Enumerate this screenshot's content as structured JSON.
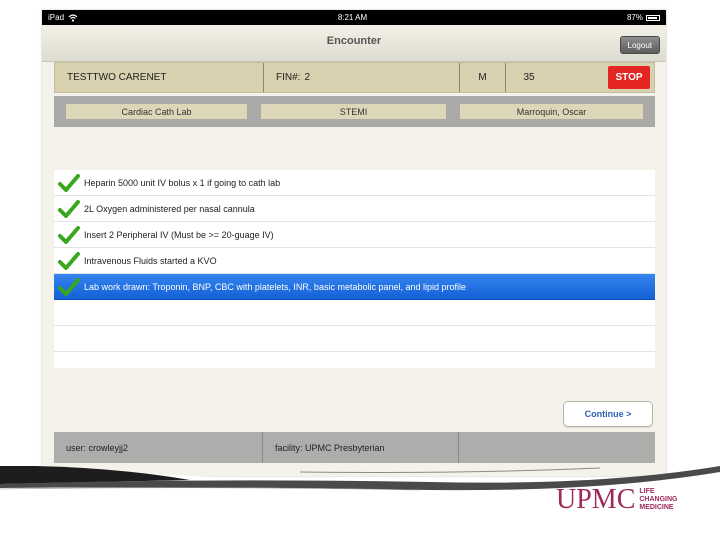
{
  "statusbar": {
    "device": "iPad",
    "time": "8:21 AM",
    "battery": "87%"
  },
  "navbar": {
    "title": "Encounter",
    "logout_label": "Logout"
  },
  "patient": {
    "name": "TESTTWO CARENET",
    "fin_label": "FIN#:",
    "fin_value": "2",
    "sex": "M",
    "age": "35",
    "stop_label": "STOP"
  },
  "context": {
    "location": "Cardiac Cath Lab",
    "protocol": "STEMI",
    "physician": "Marroquin, Oscar"
  },
  "checklist": [
    {
      "text": "Heparin 5000 unit IV bolus x 1 if going to cath lab",
      "checked": true
    },
    {
      "text": "2L Oxygen administered per nasal cannula",
      "checked": true
    },
    {
      "text": "Insert 2 Peripheral IV (Must be >= 20-guage IV)",
      "checked": true
    },
    {
      "text": "Intravenous Fluids started a KVO",
      "checked": true
    },
    {
      "text": "Lab work drawn: Troponin, BNP, CBC with platelets, INR, basic metabolic panel, and lipid profile",
      "checked": true,
      "selected": true
    }
  ],
  "continue_label": "Continue >",
  "footer": {
    "user": "user: crowleyjj2",
    "facility": "facility: UPMC Presbyterian"
  },
  "logo": {
    "brand": "UPMC",
    "tagline": [
      "LIFE",
      "CHANGING",
      "MEDICINE"
    ]
  },
  "colors": {
    "stop": "#e32622",
    "selection": "#1f6fe2",
    "check": "#3aa61e",
    "brand": "#9d2a5b"
  }
}
